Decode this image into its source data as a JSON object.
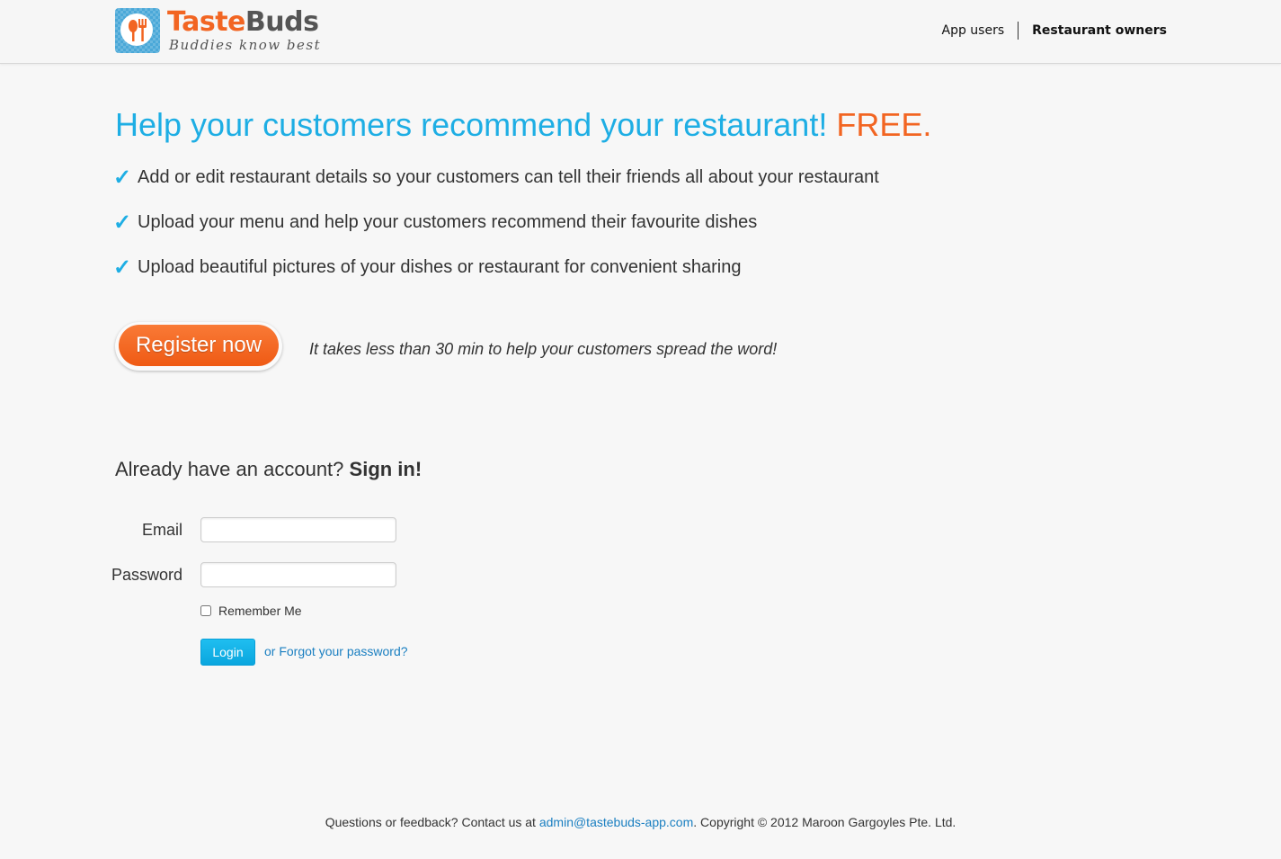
{
  "brand": {
    "name_part1": "Taste",
    "name_part2": "Buds",
    "tagline": "Buddies know best",
    "accent_color": "#f26522",
    "icon_color": "#4aa8d8"
  },
  "nav": {
    "app_users": "App users",
    "restaurant_owners": "Restaurant owners"
  },
  "hero": {
    "headline": "Help your customers recommend your restaurant!",
    "headline_free": "FREE.",
    "headline_color": "#1eaee4",
    "check_glyph": "✓",
    "features": [
      "Add or edit restaurant details so your customers can tell their friends all about your restaurant",
      "Upload your menu and help your customers recommend their favourite dishes",
      "Upload beautiful pictures of your dishes or restaurant for convenient sharing"
    ]
  },
  "register": {
    "button_label": "Register now",
    "note": "It takes less than 30 min to help your customers spread the word!"
  },
  "signin": {
    "prompt": "Already have an account?",
    "prompt_bold": "Sign in!",
    "email_label": "Email",
    "email_value": "",
    "password_label": "Password",
    "password_value": "",
    "remember_label": "Remember Me",
    "remember_checked": false,
    "login_label": "Login",
    "forgot_label": "or Forgot your password?"
  },
  "footer": {
    "prefix": "Questions or feedback? Contact us at",
    "email": "admin@tastebuds-app.com",
    "suffix": ". Copyright © 2012 Maroon Gargoyles Pte. Ltd."
  }
}
